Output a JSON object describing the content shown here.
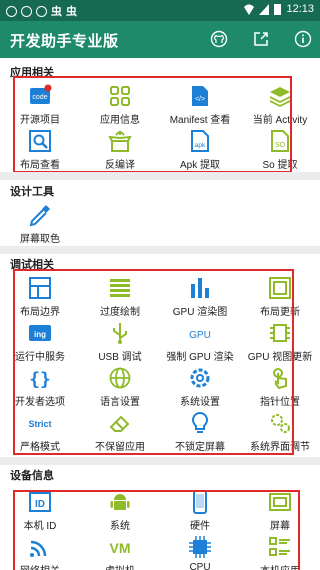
{
  "status": {
    "time": "12:13"
  },
  "appbar": {
    "title": "开发助手专业版"
  },
  "sections": {
    "app": {
      "title": "应用相关",
      "items": [
        {
          "label": "开源项目",
          "icon": "code-file-icon"
        },
        {
          "label": "应用信息",
          "icon": "grid-apps-icon"
        },
        {
          "label": "Manifest 查看",
          "icon": "xml-file-icon"
        },
        {
          "label": "当前 Activity",
          "icon": "layers-icon"
        },
        {
          "label": "布局查看",
          "icon": "layout-search-icon"
        },
        {
          "label": "反编译",
          "icon": "box-unpack-icon"
        },
        {
          "label": "Apk 提取",
          "icon": "apk-file-icon"
        },
        {
          "label": "So 提取",
          "icon": "so-file-icon"
        }
      ]
    },
    "design": {
      "title": "设计工具",
      "items": [
        {
          "label": "屏幕取色",
          "icon": "eyedropper-icon"
        }
      ]
    },
    "debug": {
      "title": "调试相关",
      "items": [
        {
          "label": "布局边界",
          "icon": "layout-bounds-icon"
        },
        {
          "label": "过度绘制",
          "icon": "overdraw-icon"
        },
        {
          "label": "GPU 渲染图",
          "icon": "gpu-bars-icon"
        },
        {
          "label": "布局更新",
          "icon": "layout-update-icon"
        },
        {
          "label": "运行中服务",
          "icon": "running-service-icon"
        },
        {
          "label": "USB 调试",
          "icon": "usb-icon"
        },
        {
          "label": "强制 GPU 渲染",
          "icon": "gpu-text-icon"
        },
        {
          "label": "GPU 视图更新",
          "icon": "gpu-view-icon"
        },
        {
          "label": "开发者选项",
          "icon": "braces-icon"
        },
        {
          "label": "语言设置",
          "icon": "globe-icon"
        },
        {
          "label": "系统设置",
          "icon": "settings-gear-icon"
        },
        {
          "label": "指针位置",
          "icon": "touch-pointer-icon"
        },
        {
          "label": "严格模式",
          "icon": "strict-text-icon"
        },
        {
          "label": "不保留应用",
          "icon": "eraser-icon"
        },
        {
          "label": "不锁定屏幕",
          "icon": "bulb-icon"
        },
        {
          "label": "系统界面调节",
          "icon": "gears-icon"
        }
      ]
    },
    "device": {
      "title": "设备信息",
      "items": [
        {
          "label": "本机 ID",
          "icon": "id-card-icon"
        },
        {
          "label": "系统",
          "icon": "android-icon"
        },
        {
          "label": "硬件",
          "icon": "phone-hardware-icon"
        },
        {
          "label": "屏幕",
          "icon": "screen-icon"
        },
        {
          "label": "网络相关",
          "icon": "wifi-icon"
        },
        {
          "label": "虚拟机",
          "icon": "vm-text-icon"
        },
        {
          "label": "CPU",
          "icon": "cpu-chip-icon"
        },
        {
          "label": "本机应用",
          "icon": "app-list-icon"
        }
      ]
    }
  },
  "badges": {
    "code": "code",
    "xml": "</>",
    "apk": "apk",
    "so": "SO",
    "ing": "ing",
    "gpu": "GPU",
    "strict": "Strict",
    "vm": "VM",
    "id": "ID"
  },
  "colors": {
    "accent": "#1e8a69",
    "statusbar": "#166a51",
    "highlight": "#e02a2a",
    "blue": "#1d7fd6",
    "green": "#8fbb2a"
  }
}
